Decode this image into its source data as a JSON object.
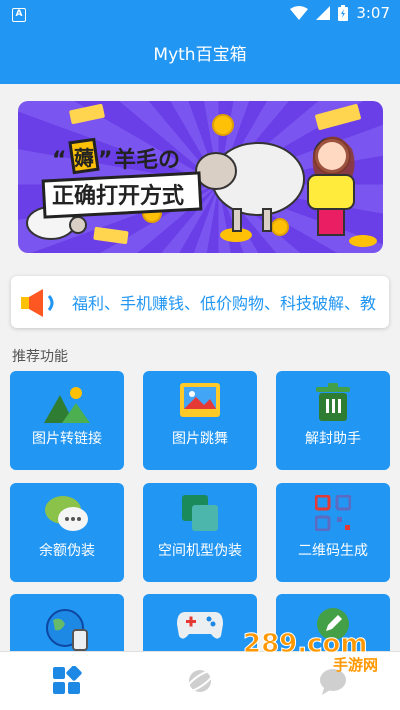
{
  "status_bar": {
    "time": "3:07"
  },
  "app": {
    "title": "Myth百宝箱"
  },
  "banner": {
    "quote_char": "薅",
    "line1_rest": "羊毛の",
    "line2": "正确打开方式"
  },
  "marquee": {
    "text": "福利、手机赚钱、低价购物、科技破解、教"
  },
  "section": {
    "title": "推荐功能"
  },
  "features": [
    {
      "label": "图片转链接",
      "icon": "mountain-image-icon"
    },
    {
      "label": "图片跳舞",
      "icon": "photo-frame-icon"
    },
    {
      "label": "解封助手",
      "icon": "trash-bin-icon"
    },
    {
      "label": "余额伪装",
      "icon": "chat-bubbles-icon"
    },
    {
      "label": "空间机型伪装",
      "icon": "stacked-cards-icon"
    },
    {
      "label": "二维码生成",
      "icon": "qr-code-icon"
    },
    {
      "label": "",
      "icon": "globe-luggage-icon"
    },
    {
      "label": "",
      "icon": "gamepad-icon"
    },
    {
      "label": "",
      "icon": "edit-icon"
    }
  ],
  "bottom_nav": [
    {
      "name": "nav-home",
      "icon": "grid-icon",
      "active": true
    },
    {
      "name": "nav-discover",
      "icon": "planet-icon",
      "active": false
    },
    {
      "name": "nav-messages",
      "icon": "chat-icon",
      "active": false
    }
  ],
  "watermark": {
    "text1": "289.com",
    "text2": "手游网"
  },
  "colors": {
    "primary": "#2196f3",
    "banner_bg": "#6a3fe8",
    "accent_yellow": "#ffc107"
  }
}
